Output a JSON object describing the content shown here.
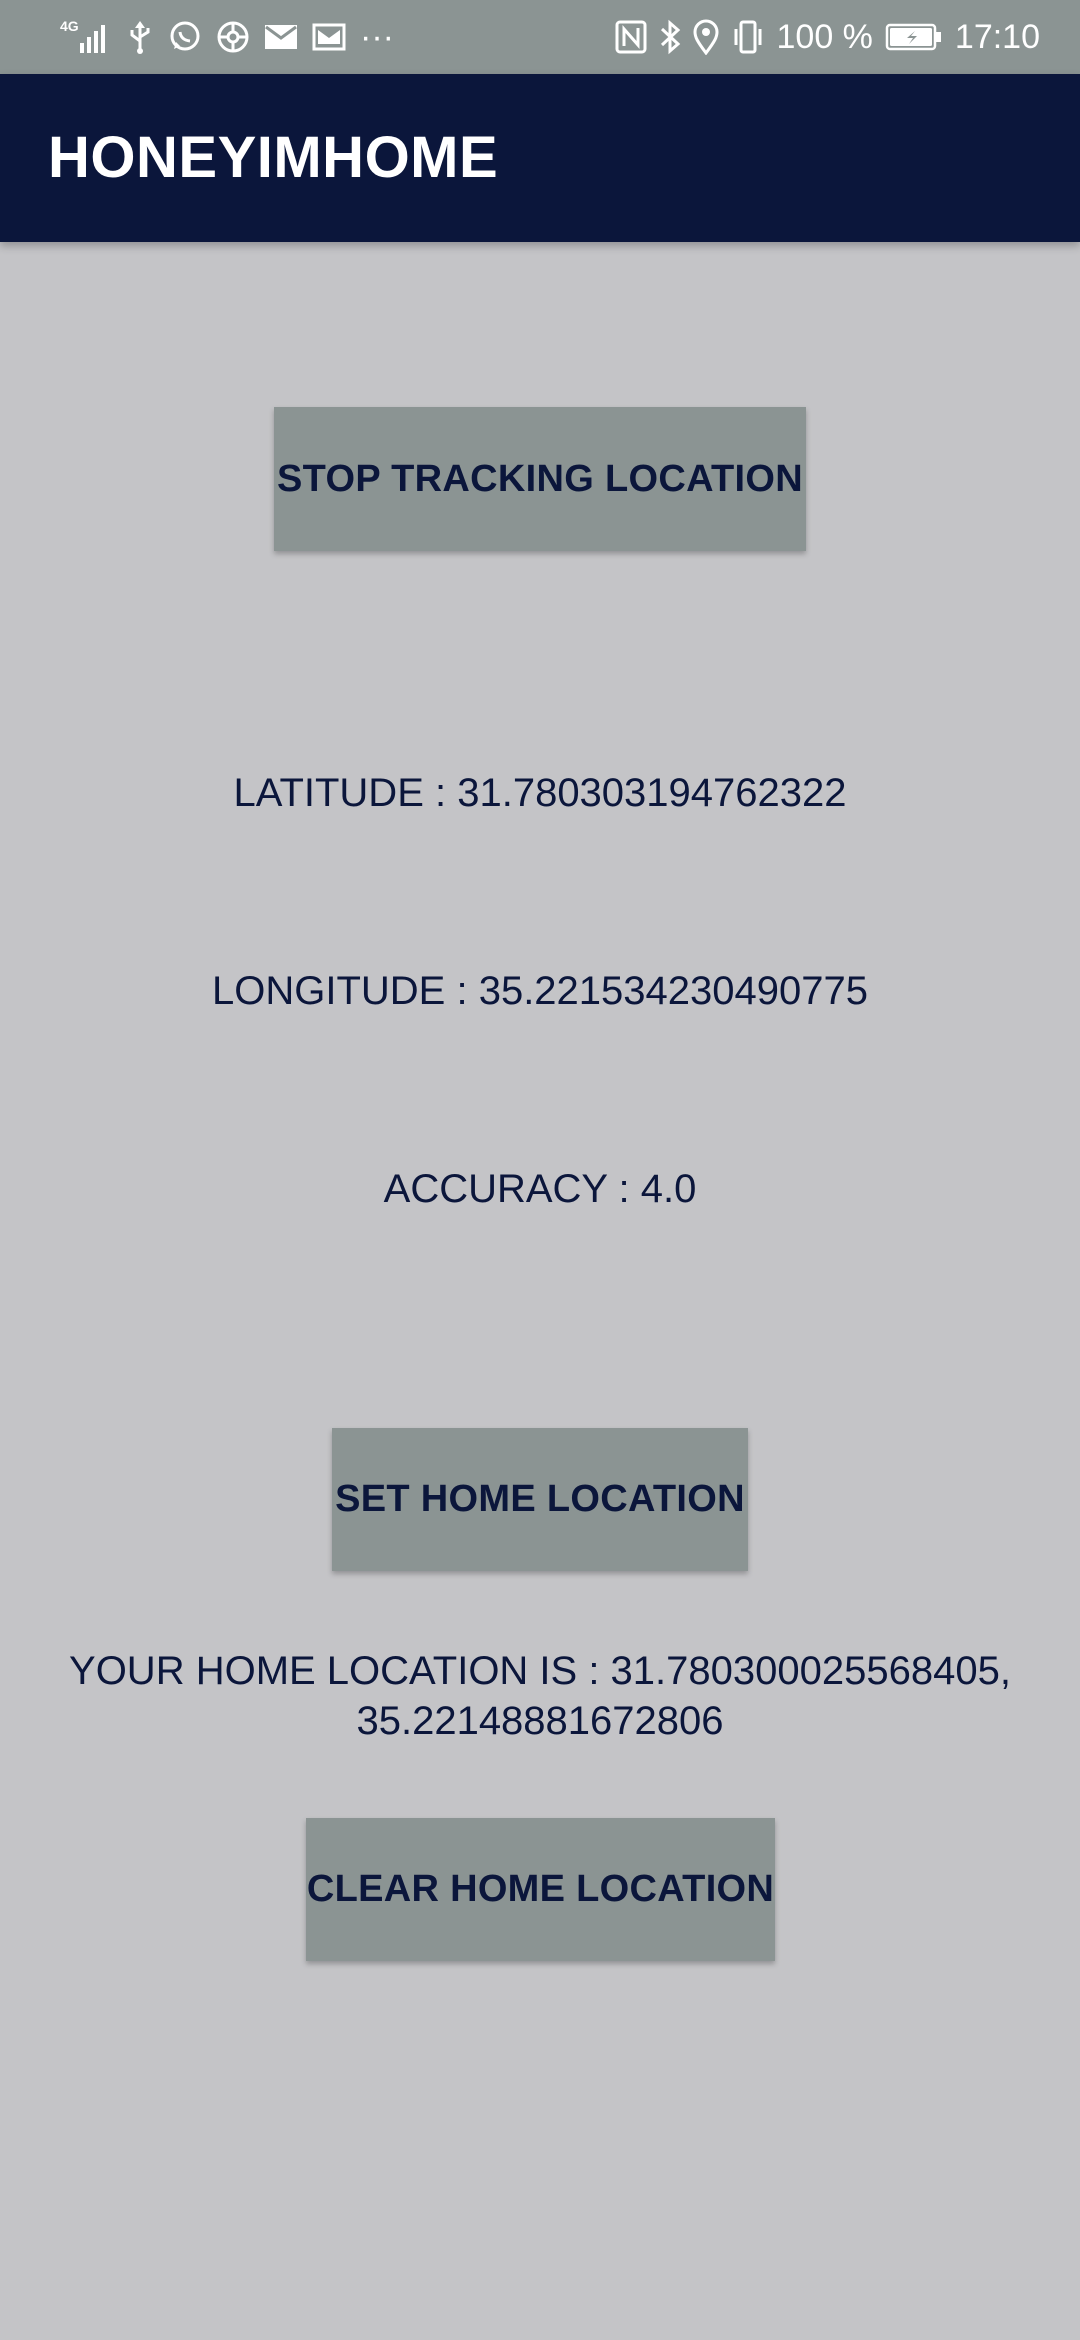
{
  "status_bar": {
    "network": "4G",
    "battery": "100 %",
    "time": "17:10",
    "overflow": "···",
    "icons_left": [
      "signal-icon",
      "usb-icon",
      "whatsapp-icon",
      "app-icon",
      "email-icon",
      "gmail-icon"
    ],
    "icons_right": [
      "nfc-icon",
      "bluetooth-icon",
      "location-icon",
      "vibrate-icon",
      "battery-icon"
    ]
  },
  "app_bar": {
    "title": "HONEYIMHOME"
  },
  "main": {
    "tracking_button": "STOP TRACKING LOCATION",
    "latitude": "LATITUDE : 31.780303194762322",
    "longitude": "LONGITUDE : 35.221534230490775",
    "accuracy": "ACCURACY : 4.0",
    "set_home_button": "SET HOME LOCATION",
    "home_location_line1": "YOUR HOME LOCATION IS : 31.780300025568405,",
    "home_location_line2": "35.22148881672806",
    "clear_home_button": "CLEAR HOME LOCATION"
  },
  "colors": {
    "status_bar": "#8b9493",
    "app_bar": "#0b163b",
    "background": "#c4c4c7",
    "button": "#8b9493",
    "text": "#0b163b"
  }
}
